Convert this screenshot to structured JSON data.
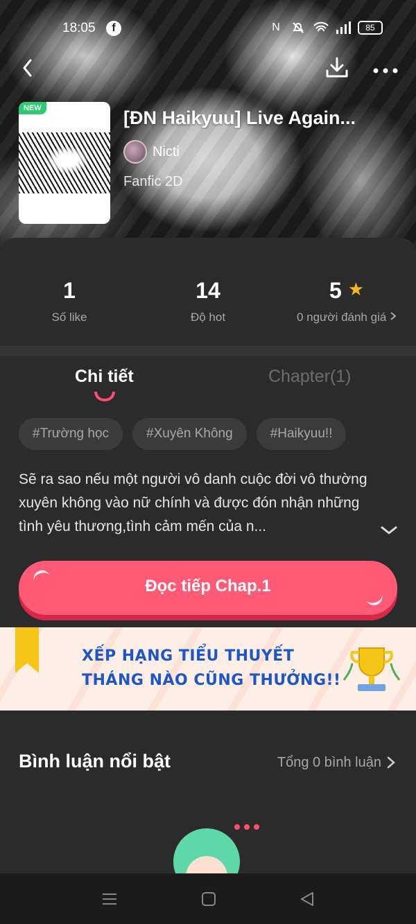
{
  "status_bar": {
    "time": "18:05",
    "battery": "85"
  },
  "novel": {
    "badge": "NEW",
    "title": "[ĐN Haikyuu] Live Again...",
    "author": "Nicti",
    "genre": "Fanfic 2D"
  },
  "stats": {
    "likes": {
      "value": "1",
      "label": "Số like"
    },
    "hot": {
      "value": "14",
      "label": "Độ hot"
    },
    "rating": {
      "value": "5",
      "label": "0 người đánh giá"
    }
  },
  "tabs": {
    "detail": "Chi tiết",
    "chapter": "Chapter(1)"
  },
  "tags": [
    "#Trường học",
    "#Xuyên Không",
    "#Haikyuu!!"
  ],
  "synopsis": "Sẽ ra sao nếu một người vô danh cuộc đời vô thường xuyên không vào nữ chính và được đón nhận những tình yêu thương,tình cảm mến của n...",
  "read_button": "Đọc tiếp Chap.1",
  "banner": {
    "line1": "XẾP HẠNG TIỂU THUYẾT",
    "line2": "THÁNG NÀO CŨNG THƯỞNG!!"
  },
  "comments": {
    "title": "Bình luận nổi bật",
    "count": "Tổng 0 bình luận"
  },
  "colors": {
    "accent": "#ff5a76",
    "star": "#f5b81b",
    "background": "#2b2b2b"
  },
  "icons": {
    "back": "chevron-left-icon",
    "download": "download-icon",
    "more": "more-horizontal-icon",
    "star": "star-icon"
  }
}
